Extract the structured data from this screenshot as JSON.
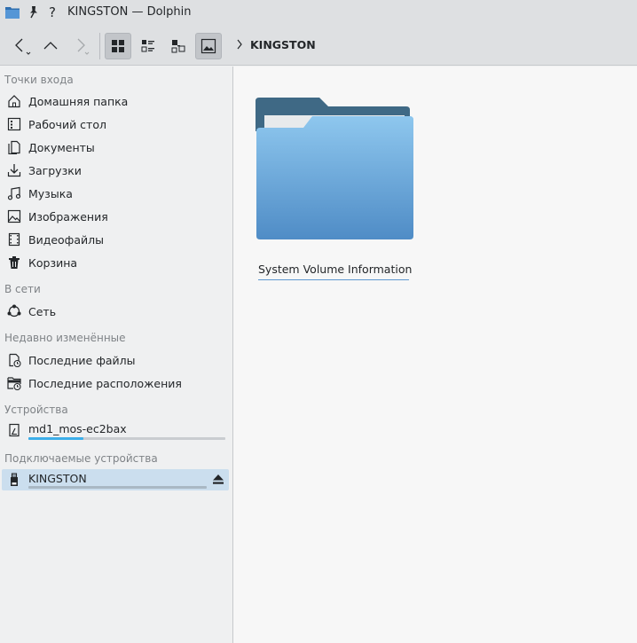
{
  "window": {
    "title": "KINGSTON — Dolphin",
    "help_glyph": "?"
  },
  "toolbar": {
    "breadcrumb": [
      "KINGSTON"
    ]
  },
  "sidebar": {
    "sections": [
      {
        "title": "Точки входа",
        "items": [
          {
            "label": "Домашняя папка",
            "icon": "home-icon"
          },
          {
            "label": "Рабочий стол",
            "icon": "desktop-icon"
          },
          {
            "label": "Документы",
            "icon": "documents-icon"
          },
          {
            "label": "Загрузки",
            "icon": "downloads-icon"
          },
          {
            "label": "Музыка",
            "icon": "music-icon"
          },
          {
            "label": "Изображения",
            "icon": "pictures-icon"
          },
          {
            "label": "Видеофайлы",
            "icon": "videos-icon"
          },
          {
            "label": "Корзина",
            "icon": "trash-icon"
          }
        ]
      },
      {
        "title": "В сети",
        "items": [
          {
            "label": "Сеть",
            "icon": "network-icon"
          }
        ]
      },
      {
        "title": "Недавно изменённые",
        "items": [
          {
            "label": "Последние файлы",
            "icon": "recent-files-icon"
          },
          {
            "label": "Последние расположения",
            "icon": "recent-locations-icon"
          }
        ]
      },
      {
        "title": "Устройства",
        "items": [
          {
            "label": "md1_mos-ec2bax",
            "icon": "drive-icon",
            "usage_fraction": 0.28
          }
        ]
      },
      {
        "title": "Подключаемые устройства",
        "items": [
          {
            "label": "KINGSTON",
            "icon": "usb-drive-icon",
            "usage_fraction": 0.0,
            "selected": true
          }
        ]
      }
    ]
  },
  "content": {
    "items": [
      {
        "name": "System Volume Information",
        "icon": "folder-icon"
      }
    ]
  },
  "colors": {
    "accent": "#3daee9",
    "folder_front": "#5b9bd5",
    "folder_back": "#3f6985",
    "selection": "#cbdeee"
  }
}
